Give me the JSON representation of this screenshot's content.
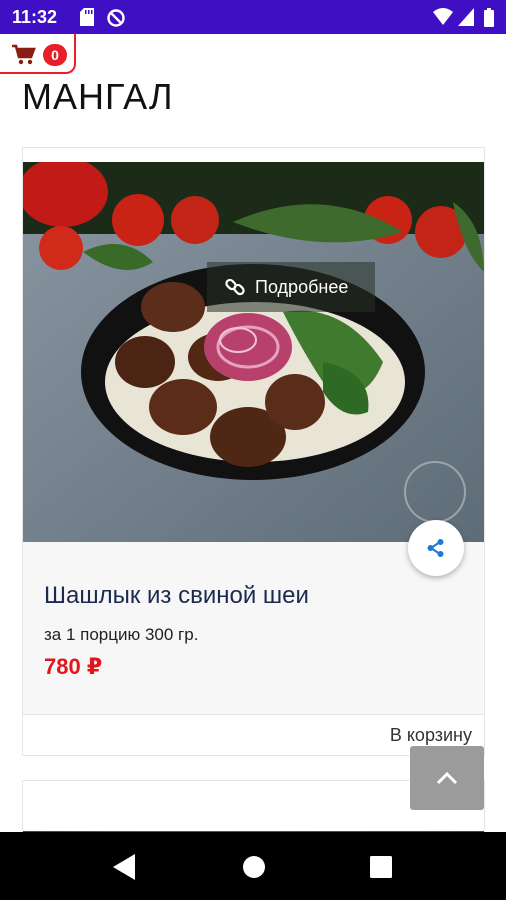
{
  "status_bar": {
    "time": "11:32"
  },
  "cart": {
    "count": "0"
  },
  "section": {
    "title": "МАНГАЛ"
  },
  "product": {
    "details_label": "Подробнее",
    "name": "Шашлык из свиной шеи",
    "portion": "за 1 порцию 300 гр.",
    "price": "780 ₽",
    "add_to_cart_label": "В корзину"
  },
  "colors": {
    "status_bar": "#3f0fc4",
    "accent_red": "#e0161e",
    "title_navy": "#1c2a4f",
    "share_blue": "#1e78d6"
  }
}
